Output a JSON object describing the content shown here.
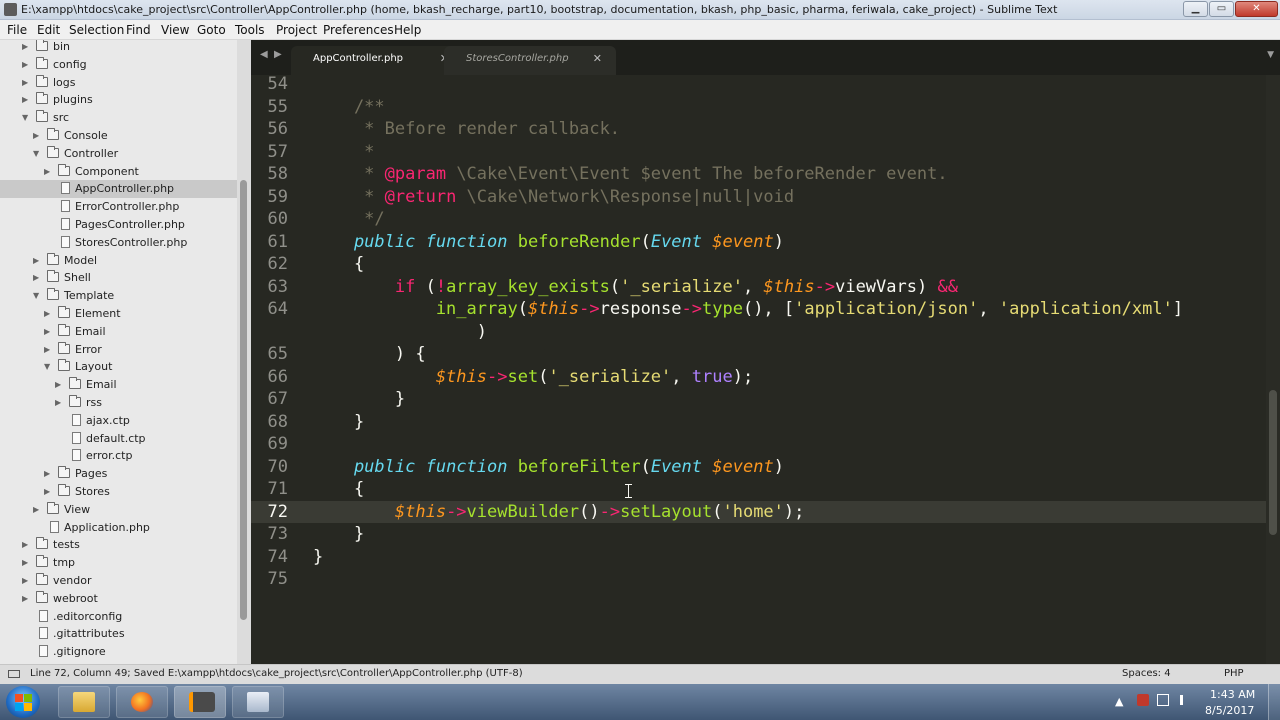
{
  "window": {
    "title": "E:\\xampp\\htdocs\\cake_project\\src\\Controller\\AppController.php (home, bkash_recharge, part10, bootstrap, documentation, bkash, php_basic, pharma, feriwala, cake_project) - Sublime Text",
    "min": "▁",
    "max": "▭",
    "close": "✕"
  },
  "menu": [
    "File",
    "Edit",
    "Selection",
    "Find",
    "View",
    "Goto",
    "Tools",
    "Project",
    "Preferences",
    "Help"
  ],
  "sidebar": {
    "items": [
      {
        "label": "bin",
        "kind": "folder",
        "depth": 0,
        "arrow": "▶"
      },
      {
        "label": "config",
        "kind": "folder",
        "depth": 0,
        "arrow": "▶"
      },
      {
        "label": "logs",
        "kind": "folder",
        "depth": 0,
        "arrow": "▶"
      },
      {
        "label": "plugins",
        "kind": "folder",
        "depth": 0,
        "arrow": "▶"
      },
      {
        "label": "src",
        "kind": "folder",
        "depth": 0,
        "arrow": "▼"
      },
      {
        "label": "Console",
        "kind": "folder",
        "depth": 1,
        "arrow": "▶"
      },
      {
        "label": "Controller",
        "kind": "folder",
        "depth": 1,
        "arrow": "▼"
      },
      {
        "label": "Component",
        "kind": "folder",
        "depth": 2,
        "arrow": "▶"
      },
      {
        "label": "AppController.php",
        "kind": "file",
        "depth": 2,
        "arrow": "",
        "selected": true
      },
      {
        "label": "ErrorController.php",
        "kind": "file",
        "depth": 2,
        "arrow": ""
      },
      {
        "label": "PagesController.php",
        "kind": "file",
        "depth": 2,
        "arrow": ""
      },
      {
        "label": "StoresController.php",
        "kind": "file",
        "depth": 2,
        "arrow": ""
      },
      {
        "label": "Model",
        "kind": "folder",
        "depth": 1,
        "arrow": "▶"
      },
      {
        "label": "Shell",
        "kind": "folder",
        "depth": 1,
        "arrow": "▶"
      },
      {
        "label": "Template",
        "kind": "folder",
        "depth": 1,
        "arrow": "▼"
      },
      {
        "label": "Element",
        "kind": "folder",
        "depth": 2,
        "arrow": "▶"
      },
      {
        "label": "Email",
        "kind": "folder",
        "depth": 2,
        "arrow": "▶"
      },
      {
        "label": "Error",
        "kind": "folder",
        "depth": 2,
        "arrow": "▶"
      },
      {
        "label": "Layout",
        "kind": "folder",
        "depth": 2,
        "arrow": "▼"
      },
      {
        "label": "Email",
        "kind": "folder",
        "depth": 3,
        "arrow": "▶"
      },
      {
        "label": "rss",
        "kind": "folder",
        "depth": 3,
        "arrow": "▶"
      },
      {
        "label": "ajax.ctp",
        "kind": "file",
        "depth": 3,
        "arrow": ""
      },
      {
        "label": "default.ctp",
        "kind": "file",
        "depth": 3,
        "arrow": ""
      },
      {
        "label": "error.ctp",
        "kind": "file",
        "depth": 3,
        "arrow": ""
      },
      {
        "label": "Pages",
        "kind": "folder",
        "depth": 2,
        "arrow": "▶"
      },
      {
        "label": "Stores",
        "kind": "folder",
        "depth": 2,
        "arrow": "▶"
      },
      {
        "label": "View",
        "kind": "folder",
        "depth": 1,
        "arrow": "▶"
      },
      {
        "label": "Application.php",
        "kind": "file",
        "depth": 1,
        "arrow": ""
      },
      {
        "label": "tests",
        "kind": "folder",
        "depth": 0,
        "arrow": "▶"
      },
      {
        "label": "tmp",
        "kind": "folder",
        "depth": 0,
        "arrow": "▶"
      },
      {
        "label": "vendor",
        "kind": "folder",
        "depth": 0,
        "arrow": "▶"
      },
      {
        "label": "webroot",
        "kind": "folder",
        "depth": 0,
        "arrow": "▶"
      },
      {
        "label": ".editorconfig",
        "kind": "file",
        "depth": 0,
        "arrow": ""
      },
      {
        "label": ".gitattributes",
        "kind": "file",
        "depth": 0,
        "arrow": ""
      },
      {
        "label": ".gitignore",
        "kind": "file",
        "depth": 0,
        "arrow": ""
      }
    ]
  },
  "tabs": {
    "nav_left": "◀",
    "nav_right": "▶",
    "menu": "▼",
    "items": [
      {
        "label": "AppController.php",
        "close": "✕",
        "active": true
      },
      {
        "label": "StoresController.php",
        "close": "✕",
        "active": false
      }
    ]
  },
  "editor": {
    "current_line": "72",
    "lines": [
      {
        "n": "54",
        "tokens": []
      },
      {
        "n": "55",
        "tokens": [
          [
            "cm",
            "    /**"
          ]
        ]
      },
      {
        "n": "56",
        "tokens": [
          [
            "cm",
            "     * Before render callback."
          ]
        ]
      },
      {
        "n": "57",
        "tokens": [
          [
            "cm",
            "     *"
          ]
        ]
      },
      {
        "n": "58",
        "tokens": [
          [
            "cm",
            "     * "
          ],
          [
            "tag",
            "@param"
          ],
          [
            "cm",
            " \\Cake\\Event\\Event $event The beforeRender event."
          ]
        ]
      },
      {
        "n": "59",
        "tokens": [
          [
            "cm",
            "     * "
          ],
          [
            "tag",
            "@return"
          ],
          [
            "cm",
            " \\Cake\\Network\\Response|null|void"
          ]
        ]
      },
      {
        "n": "60",
        "tokens": [
          [
            "cm",
            "     */"
          ]
        ]
      },
      {
        "n": "61",
        "tokens": [
          [
            "st",
            "    public"
          ],
          [
            "pl",
            " "
          ],
          [
            "ty",
            "function"
          ],
          [
            "pl",
            " "
          ],
          [
            "fn",
            "beforeRender"
          ],
          [
            "pl",
            "("
          ],
          [
            "ty",
            "Event"
          ],
          [
            "pl",
            " "
          ],
          [
            "var",
            "$event"
          ],
          [
            "pl",
            ")"
          ]
        ]
      },
      {
        "n": "62",
        "tokens": [
          [
            "pl",
            "    {"
          ]
        ]
      },
      {
        "n": "63",
        "tokens": [
          [
            "kw",
            "        if"
          ],
          [
            "pl",
            " ("
          ],
          [
            "kw",
            "!"
          ],
          [
            "fn",
            "array_key_exists"
          ],
          [
            "pl",
            "("
          ],
          [
            "str",
            "'_serialize'"
          ],
          [
            "pl",
            ", "
          ],
          [
            "var",
            "$this"
          ],
          [
            "kw",
            "->"
          ],
          [
            "pl",
            "viewVars) "
          ],
          [
            "kw",
            "&&"
          ]
        ]
      },
      {
        "n": "64",
        "tokens": [
          [
            "fn",
            "            in_array"
          ],
          [
            "pl",
            "("
          ],
          [
            "var",
            "$this"
          ],
          [
            "kw",
            "->"
          ],
          [
            "pl",
            "response"
          ],
          [
            "kw",
            "->"
          ],
          [
            "fn",
            "type"
          ],
          [
            "pl",
            "(), ["
          ],
          [
            "str",
            "'application/json'"
          ],
          [
            "pl",
            ", "
          ],
          [
            "str",
            "'application/xml'"
          ],
          [
            "pl",
            "]"
          ]
        ]
      },
      {
        "n": "",
        "tokens": [
          [
            "pl",
            "                )"
          ]
        ]
      },
      {
        "n": "65",
        "tokens": [
          [
            "pl",
            "        ) {"
          ]
        ]
      },
      {
        "n": "66",
        "tokens": [
          [
            "var",
            "            $this"
          ],
          [
            "kw",
            "->"
          ],
          [
            "fn",
            "set"
          ],
          [
            "pl",
            "("
          ],
          [
            "str",
            "'_serialize'"
          ],
          [
            "pl",
            ", "
          ],
          [
            "con",
            "true"
          ],
          [
            "pl",
            ");"
          ]
        ]
      },
      {
        "n": "67",
        "tokens": [
          [
            "pl",
            "        }"
          ]
        ]
      },
      {
        "n": "68",
        "tokens": [
          [
            "pl",
            "    }"
          ]
        ]
      },
      {
        "n": "69",
        "tokens": []
      },
      {
        "n": "70",
        "tokens": [
          [
            "st",
            "    public"
          ],
          [
            "pl",
            " "
          ],
          [
            "ty",
            "function"
          ],
          [
            "pl",
            " "
          ],
          [
            "fn",
            "beforeFilter"
          ],
          [
            "pl",
            "("
          ],
          [
            "ty",
            "Event"
          ],
          [
            "pl",
            " "
          ],
          [
            "var",
            "$event"
          ],
          [
            "pl",
            ")"
          ]
        ]
      },
      {
        "n": "71",
        "tokens": [
          [
            "pl",
            "    {"
          ]
        ]
      },
      {
        "n": "72",
        "tokens": [
          [
            "var",
            "        $this"
          ],
          [
            "kw",
            "->"
          ],
          [
            "fn",
            "viewBuilder"
          ],
          [
            "pl",
            "()"
          ],
          [
            "kw",
            "->"
          ],
          [
            "fn",
            "setLayout"
          ],
          [
            "pl",
            "("
          ],
          [
            "str",
            "'home'"
          ],
          [
            "pl",
            ");"
          ]
        ]
      },
      {
        "n": "73",
        "tokens": [
          [
            "pl",
            "    }"
          ]
        ]
      },
      {
        "n": "74",
        "tokens": [
          [
            "pl",
            "}"
          ]
        ]
      },
      {
        "n": "75",
        "tokens": []
      }
    ]
  },
  "status": {
    "text": "Line 72, Column 49; Saved E:\\xampp\\htdocs\\cake_project\\src\\Controller\\AppController.php (UTF-8)",
    "indent": "Spaces: 4",
    "syntax": "PHP"
  },
  "taskbar": {
    "time": "1:43 AM",
    "date": "8/5/2017",
    "tray_up": "▲"
  },
  "colors": {
    "editor_bg": "#272822",
    "keyword": "#f92672",
    "function": "#a6e22e",
    "string": "#e6db74",
    "variable": "#fd971f",
    "storage": "#66d9ef",
    "comment": "#75715e",
    "constant": "#ae81ff"
  }
}
